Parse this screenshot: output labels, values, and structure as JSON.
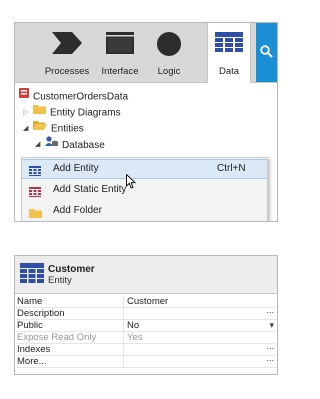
{
  "tabs": [
    {
      "label": "Processes",
      "icon": "processes-icon"
    },
    {
      "label": "Interface",
      "icon": "interface-icon"
    },
    {
      "label": "Logic",
      "icon": "logic-icon"
    },
    {
      "label": "Data",
      "icon": "data-grid-icon",
      "active": true
    }
  ],
  "search": {
    "icon": "search-icon"
  },
  "tree": {
    "root": "CustomerOrdersData",
    "entity_diagrams": "Entity Diagrams",
    "entities": "Entities",
    "database": "Database"
  },
  "context_menu": {
    "items": [
      {
        "label": "Add Entity",
        "shortcut": "Ctrl+N",
        "icon": "entity-icon",
        "hovered": true
      },
      {
        "label": "Add Static Entity",
        "shortcut": "",
        "icon": "static-entity-icon"
      },
      {
        "label": "Add Folder",
        "shortcut": "",
        "icon": "folder-icon"
      }
    ]
  },
  "properties": {
    "title": "Customer",
    "subtitle": "Entity",
    "rows": [
      {
        "key": "Name",
        "value": "Customer",
        "edit": ""
      },
      {
        "key": "Description",
        "value": "",
        "edit": "..."
      },
      {
        "key": "Public",
        "value": "No",
        "edit": "▾"
      },
      {
        "key": "Expose Read Only",
        "value": "Yes",
        "edit": ""
      },
      {
        "key": "Indexes",
        "value": "",
        "edit": "..."
      },
      {
        "key": "More...",
        "value": "",
        "edit": "..."
      }
    ]
  },
  "colors": {
    "accent": "#1a8fd6",
    "entity": "#2e4ea8",
    "static_entity": "#b5344a",
    "folder": "#f2c14e"
  }
}
